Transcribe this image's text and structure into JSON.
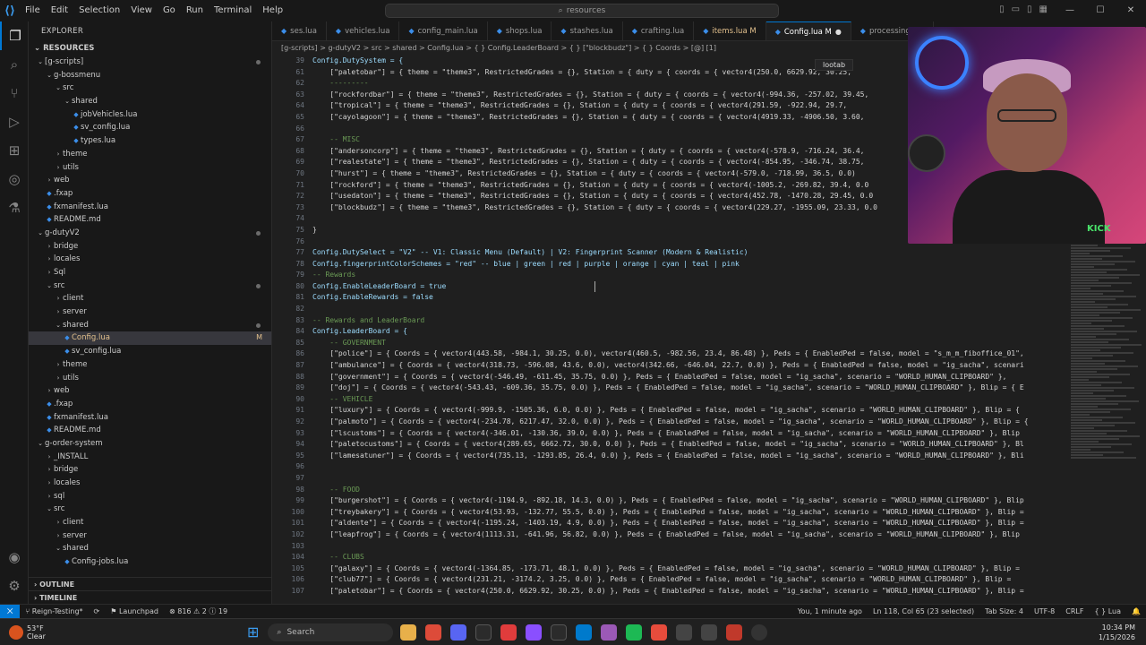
{
  "titlebar": {
    "menu": [
      "File",
      "Edit",
      "Selection",
      "View",
      "Go",
      "Run",
      "Terminal",
      "Help"
    ],
    "search_text": "resources",
    "logo": "vscode-logo"
  },
  "activity_icons": [
    "explorer-icon",
    "search-icon",
    "source-control-icon",
    "run-debug-icon",
    "extensions-icon",
    "remote-icon",
    "testing-icon"
  ],
  "sidebar": {
    "header": "EXPLORER",
    "root": "RESOURCES",
    "tree": [
      {
        "label": "[g-scripts]",
        "depth": 0,
        "type": "folder",
        "open": true,
        "dot": true
      },
      {
        "label": "g-bossmenu",
        "depth": 1,
        "type": "folder",
        "open": true
      },
      {
        "label": "src",
        "depth": 2,
        "type": "folder",
        "open": true
      },
      {
        "label": "shared",
        "depth": 3,
        "type": "folder",
        "open": true
      },
      {
        "label": "jobVehicles.lua",
        "depth": 4,
        "type": "file"
      },
      {
        "label": "sv_config.lua",
        "depth": 4,
        "type": "file"
      },
      {
        "label": "types.lua",
        "depth": 4,
        "type": "file"
      },
      {
        "label": "theme",
        "depth": 2,
        "type": "folder",
        "open": false
      },
      {
        "label": "utils",
        "depth": 2,
        "type": "folder",
        "open": false
      },
      {
        "label": "web",
        "depth": 1,
        "type": "folder",
        "open": false
      },
      {
        "label": ".fxap",
        "depth": 1,
        "type": "file"
      },
      {
        "label": "fxmanifest.lua",
        "depth": 1,
        "type": "file"
      },
      {
        "label": "README.md",
        "depth": 1,
        "type": "file"
      },
      {
        "label": "g-dutyV2",
        "depth": 0,
        "type": "folder",
        "open": true,
        "dot": true
      },
      {
        "label": "bridge",
        "depth": 1,
        "type": "folder",
        "open": false
      },
      {
        "label": "locales",
        "depth": 1,
        "type": "folder",
        "open": false
      },
      {
        "label": "Sql",
        "depth": 1,
        "type": "folder",
        "open": false
      },
      {
        "label": "src",
        "depth": 1,
        "type": "folder",
        "open": true,
        "dot": true
      },
      {
        "label": "client",
        "depth": 2,
        "type": "folder",
        "open": false
      },
      {
        "label": "server",
        "depth": 2,
        "type": "folder",
        "open": false
      },
      {
        "label": "shared",
        "depth": 2,
        "type": "folder",
        "open": true,
        "dot": true
      },
      {
        "label": "Config.lua",
        "depth": 3,
        "type": "file",
        "selected": true,
        "badge": "M"
      },
      {
        "label": "sv_config.lua",
        "depth": 3,
        "type": "file"
      },
      {
        "label": "theme",
        "depth": 2,
        "type": "folder",
        "open": false
      },
      {
        "label": "utils",
        "depth": 2,
        "type": "folder",
        "open": false
      },
      {
        "label": "web",
        "depth": 1,
        "type": "folder",
        "open": false
      },
      {
        "label": ".fxap",
        "depth": 1,
        "type": "file"
      },
      {
        "label": "fxmanifest.lua",
        "depth": 1,
        "type": "file"
      },
      {
        "label": "README.md",
        "depth": 1,
        "type": "file"
      },
      {
        "label": "g-order-system",
        "depth": 0,
        "type": "folder",
        "open": true
      },
      {
        "label": "_INSTALL",
        "depth": 1,
        "type": "folder",
        "open": false
      },
      {
        "label": "bridge",
        "depth": 1,
        "type": "folder",
        "open": false
      },
      {
        "label": "locales",
        "depth": 1,
        "type": "folder",
        "open": false
      },
      {
        "label": "sql",
        "depth": 1,
        "type": "folder",
        "open": false
      },
      {
        "label": "src",
        "depth": 1,
        "type": "folder",
        "open": true
      },
      {
        "label": "client",
        "depth": 2,
        "type": "folder",
        "open": false
      },
      {
        "label": "server",
        "depth": 2,
        "type": "folder",
        "open": false
      },
      {
        "label": "shared",
        "depth": 2,
        "type": "folder",
        "open": true
      },
      {
        "label": "Config-jobs.lua",
        "depth": 3,
        "type": "file"
      }
    ],
    "footer": [
      "OUTLINE",
      "TIMELINE"
    ]
  },
  "tabs": [
    {
      "label": "ses.lua",
      "active": false,
      "mod": false
    },
    {
      "label": "vehicles.lua",
      "active": false,
      "mod": false
    },
    {
      "label": "config_main.lua",
      "active": false,
      "mod": false
    },
    {
      "label": "shops.lua",
      "active": false,
      "mod": false
    },
    {
      "label": "stashes.lua",
      "active": false,
      "mod": false
    },
    {
      "label": "crafting.lua",
      "active": false,
      "mod": false
    },
    {
      "label": "items.lua M",
      "active": false,
      "mod": true
    },
    {
      "label": "Config.lua M",
      "active": true,
      "mod": true
    },
    {
      "label": "processing.lua",
      "active": false,
      "mod": false
    }
  ],
  "breadcrumb": "[g-scripts] > g-dutyV2 > src > shared > Config.lua > { } Config.LeaderBoard > { } [\"blockbudz\"] > { } Coords > [@] [1]",
  "editor": {
    "line_numbers": [
      "39",
      "61",
      "62",
      "63",
      "64",
      "65",
      "66",
      "67",
      "68",
      "69",
      "70",
      "71",
      "72",
      "73",
      "74",
      "75",
      "76",
      "77",
      "78",
      "79",
      "80",
      "81",
      "82",
      "83",
      "84",
      "85",
      "86",
      "87",
      "88",
      "89",
      "90",
      "91",
      "92",
      "93",
      "94",
      "95",
      "96",
      "97",
      "98",
      "99",
      "100",
      "101",
      "102",
      "103",
      "104",
      "105",
      "106",
      "107"
    ],
    "lines": [
      {
        "t": "Config.DutySystem = {",
        "c": "kw"
      },
      {
        "t": "    [\"paletobar\"] = { theme = \"theme3\", RestrictedGrades = {}, Station = { duty = { coords = { vector4(250.0, 6629.92, 30.25,",
        "c": ""
      },
      {
        "t": "    ---------",
        "c": "cmt"
      },
      {
        "t": "    [\"rockfordbar\"] = { theme = \"theme3\", RestrictedGrades = {}, Station = { duty = { coords = { vector4(-994.36, -257.02, 39.45,",
        "c": ""
      },
      {
        "t": "    [\"tropical\"] = { theme = \"theme3\", RestrictedGrades = {}, Station = { duty = { coords = { vector4(291.59, -922.94, 29.7,",
        "c": ""
      },
      {
        "t": "    [\"cayolagoon\"] = { theme = \"theme3\", RestrictedGrades = {}, Station = { duty = { coords = { vector4(4919.33, -4906.50, 3.60,",
        "c": ""
      },
      {
        "t": "",
        "c": ""
      },
      {
        "t": "    -- MISC",
        "c": "cmt"
      },
      {
        "t": "    [\"andersoncorp\"] = { theme = \"theme3\", RestrictedGrades = {}, Station = { duty = { coords = { vector4(-578.9, -716.24, 36.4,",
        "c": ""
      },
      {
        "t": "    [\"realestate\"] = { theme = \"theme3\", RestrictedGrades = {}, Station = { duty = { coords = { vector4(-854.95, -346.74, 38.75,",
        "c": ""
      },
      {
        "t": "    [\"hurst\"] = { theme = \"theme3\", RestrictedGrades = {}, Station = { duty = { coords = { vector4(-579.0, -718.99, 36.5, 0.0)",
        "c": ""
      },
      {
        "t": "    [\"rockford\"] = { theme = \"theme3\", RestrictedGrades = {}, Station = { duty = { coords = { vector4(-1005.2, -269.82, 39.4, 0.0",
        "c": ""
      },
      {
        "t": "    [\"usedaton\"] = { theme = \"theme3\", RestrictedGrades = {}, Station = { duty = { coords = { vector4(452.78, -1470.28, 29.45, 0.0",
        "c": ""
      },
      {
        "t": "    [\"blockbudz\"] = { theme = \"theme3\", RestrictedGrades = {}, Station = { duty = { coords = { vector4(229.27, -1955.09, 23.33, 0.0",
        "c": ""
      },
      {
        "t": "",
        "c": ""
      },
      {
        "t": "}",
        "c": ""
      },
      {
        "t": "",
        "c": ""
      },
      {
        "t": "Config.DutySelect = \"V2\" -- V1: Classic Menu (Default) | V2: Fingerprint Scanner (Modern & Realistic)",
        "c": "kw"
      },
      {
        "t": "Config.fingerprintColorSchemes = \"red\" -- blue | green | red | purple | orange | cyan | teal | pink",
        "c": "kw"
      },
      {
        "t": "-- Rewards",
        "c": "cmt"
      },
      {
        "t": "Config.EnableLeaderBoard = true",
        "c": "kw"
      },
      {
        "t": "Config.EnableRewards = false",
        "c": "kw"
      },
      {
        "t": "",
        "c": ""
      },
      {
        "t": "-- Rewards and LeaderBoard",
        "c": "cmt"
      },
      {
        "t": "Config.LeaderBoard = {",
        "c": "kw"
      },
      {
        "t": "    -- GOVERNMENT",
        "c": "cmt"
      },
      {
        "t": "    [\"police\"] = { Coords = { vector4(443.58, -984.1, 30.25, 0.0), vector4(460.5, -982.56, 23.4, 86.48) }, Peds = { EnabledPed = false, model = \"s_m_m_fiboffice_01\",",
        "c": ""
      },
      {
        "t": "    [\"ambulance\"] = { Coords = { vector4(318.73, -596.08, 43.6, 0.0), vector4(342.66, -646.04, 22.7, 0.0) }, Peds = { EnabledPed = false, model = \"ig_sacha\", scenari",
        "c": ""
      },
      {
        "t": "    [\"government\"] = { Coords = { vector4(-546.49, -611.45, 35.75, 0.0) }, Peds = { EnabledPed = false, model = \"ig_sacha\", scenario = \"WORLD_HUMAN_CLIPBOARD\" },",
        "c": ""
      },
      {
        "t": "    [\"doj\"] = { Coords = { vector4(-543.43, -609.36, 35.75, 0.0) }, Peds = { EnabledPed = false, model = \"ig_sacha\", scenario = \"WORLD_HUMAN_CLIPBOARD\" }, Blip = { E",
        "c": ""
      },
      {
        "t": "    -- VEHICLE",
        "c": "cmt"
      },
      {
        "t": "    [\"luxury\"] = { Coords = { vector4(-999.9, -1505.36, 6.0, 0.0) }, Peds = { EnabledPed = false, model = \"ig_sacha\", scenario = \"WORLD_HUMAN_CLIPBOARD\" }, Blip = {",
        "c": ""
      },
      {
        "t": "    [\"palmoto\"] = { Coords = { vector4(-234.78, 6217.47, 32.0, 0.0) }, Peds = { EnabledPed = false, model = \"ig_sacha\", scenario = \"WORLD_HUMAN_CLIPBOARD\" }, Blip = {",
        "c": ""
      },
      {
        "t": "    [\"lscustoms\"] = { Coords = { vector4(-346.01, -130.36, 39.0, 0.0) }, Peds = { EnabledPed = false, model = \"ig_sacha\", scenario = \"WORLD_HUMAN_CLIPBOARD\" }, Blip",
        "c": ""
      },
      {
        "t": "    [\"paletocustoms\"] = { Coords = { vector4(289.65, 6662.72, 30.0, 0.0) }, Peds = { EnabledPed = false, model = \"ig_sacha\", scenario = \"WORLD_HUMAN_CLIPBOARD\" }, Bl",
        "c": ""
      },
      {
        "t": "    [\"lamesatuner\"] = { Coords = { vector4(735.13, -1293.85, 26.4, 0.0) }, Peds = { EnabledPed = false, model = \"ig_sacha\", scenario = \"WORLD_HUMAN_CLIPBOARD\" }, Bli",
        "c": ""
      },
      {
        "t": "",
        "c": ""
      },
      {
        "t": "",
        "c": ""
      },
      {
        "t": "    -- FOOD",
        "c": "cmt"
      },
      {
        "t": "    [\"burgershot\"] = { Coords = { vector4(-1194.9, -892.18, 14.3, 0.0) }, Peds = { EnabledPed = false, model = \"ig_sacha\", scenario = \"WORLD_HUMAN_CLIPBOARD\" }, Blip",
        "c": ""
      },
      {
        "t": "    [\"treybakery\"] = { Coords = { vector4(53.93, -132.77, 55.5, 0.0) }, Peds = { EnabledPed = false, model = \"ig_sacha\", scenario = \"WORLD_HUMAN_CLIPBOARD\" }, Blip =",
        "c": ""
      },
      {
        "t": "    [\"aldente\"] = { Coords = { vector4(-1195.24, -1403.19, 4.9, 0.0) }, Peds = { EnabledPed = false, model = \"ig_sacha\", scenario = \"WORLD_HUMAN_CLIPBOARD\" }, Blip =",
        "c": ""
      },
      {
        "t": "    [\"leapfrog\"] = { Coords = { vector4(1113.31, -641.96, 56.82, 0.0) }, Peds = { EnabledPed = false, model = \"ig_sacha\", scenario = \"WORLD_HUMAN_CLIPBOARD\" }, Blip",
        "c": ""
      },
      {
        "t": "",
        "c": ""
      },
      {
        "t": "    -- CLUBS",
        "c": "cmt"
      },
      {
        "t": "    [\"galaxy\"] = { Coords = { vector4(-1364.85, -173.71, 48.1, 0.0) }, Peds = { EnabledPed = false, model = \"ig_sacha\", scenario = \"WORLD_HUMAN_CLIPBOARD\" }, Blip =",
        "c": ""
      },
      {
        "t": "    [\"club77\"] = { Coords = { vector4(231.21, -3174.2, 3.25, 0.0) }, Peds = { EnabledPed = false, model = \"ig_sacha\", scenario = \"WORLD_HUMAN_CLIPBOARD\" }, Blip =",
        "c": ""
      },
      {
        "t": "    [\"paletobar\"] = { Coords = { vector4(250.0, 6629.92, 30.25, 0.0) }, Peds = { EnabledPed = false, model = \"ig_sacha\", scenario = \"WORLD_HUMAN_CLIPBOARD\" }, Blip =",
        "c": ""
      }
    ]
  },
  "overlay": {
    "lootab": "lootab",
    "webcam_tag": "KICK"
  },
  "statusbar": {
    "remote": "⨉",
    "branch": "Reign-Testing*",
    "sync": "⟳",
    "launchpad": "Launchpad",
    "problems": "⊗ 816  ⚠ 2  ⓘ 19",
    "blame": "You, 1 minute ago",
    "position": "Ln 118, Col 65 (23 selected)",
    "tabsize": "Tab Size: 4",
    "encoding": "UTF-8",
    "eol": "CRLF",
    "language": "{ } Lua",
    "bell": "🔔"
  },
  "taskbar": {
    "temp": "53°F",
    "condition": "Clear",
    "search": "Search",
    "time": "10:34 PM",
    "date": "1/15/2026"
  },
  "colors": {
    "accent": "#0078d4",
    "modified": "#e2c08d",
    "comment": "#6a9955",
    "string": "#ce9178",
    "keyword": "#9cdcfe"
  }
}
